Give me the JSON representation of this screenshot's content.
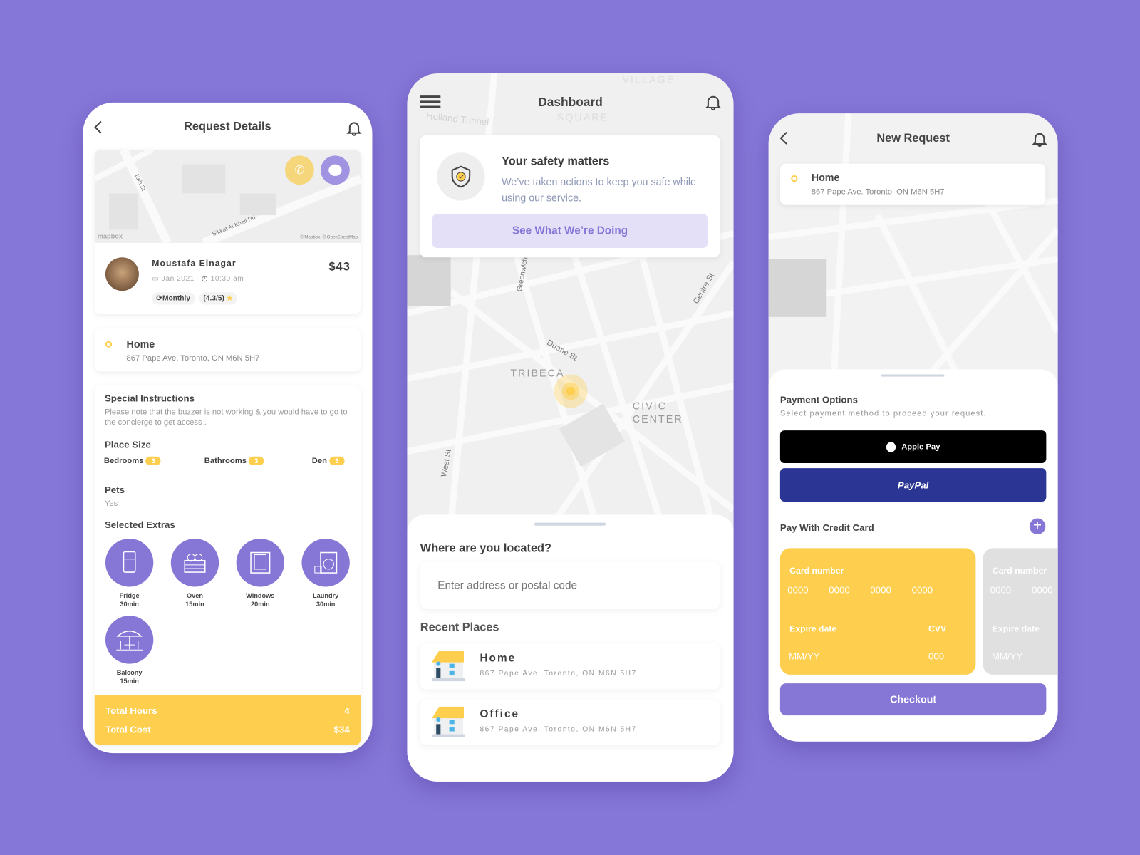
{
  "colors": {
    "background": "#8577d7",
    "accent": "#8677d6",
    "yellow": "#fecf4e",
    "paypal": "#2b3593",
    "apple": "#000000"
  },
  "request_details": {
    "title": "Request Details",
    "map": {
      "street1": "19th St",
      "street2": "Sikkat Al Khail Rd",
      "logo": "mapbox",
      "attribution": "© Mapbox, © OpenStreetMap"
    },
    "provider": {
      "name": "Moustafa Elnagar",
      "date": "Jan 2021",
      "time": "10:30 am",
      "frequency": "Monthly",
      "rating": "(4.3/5)",
      "price": "$43"
    },
    "location": {
      "name": "Home",
      "address": "867 Pape Ave. Toronto, ON M6N 5H7"
    },
    "instructions": {
      "heading": "Special Instructions",
      "text": "Please note that the buzzer is not working & you would have to go to the concierge to get access ."
    },
    "place_size": {
      "heading": "Place Size",
      "items": [
        {
          "label": "Bedrooms",
          "count": "3"
        },
        {
          "label": "Bathrooms",
          "count": "3"
        },
        {
          "label": "Den",
          "count": "3"
        }
      ]
    },
    "pets": {
      "heading": "Pets",
      "value": "Yes"
    },
    "extras": {
      "heading": "Selected Extras",
      "items": [
        {
          "label": "Fridge",
          "duration": "30min",
          "icon": "fridge-icon"
        },
        {
          "label": "Oven",
          "duration": "15min",
          "icon": "oven-icon"
        },
        {
          "label": "Windows",
          "duration": "20min",
          "icon": "window-icon"
        },
        {
          "label": "Laundry",
          "duration": "30min",
          "icon": "washing-machine-icon"
        },
        {
          "label": "Balcony",
          "duration": "15min",
          "icon": "patio-umbrella-icon"
        }
      ]
    },
    "totals": {
      "hours_label": "Total Hours",
      "hours": "4",
      "cost_label": "Total Cost",
      "cost": "$34"
    }
  },
  "dashboard": {
    "title": "Dashboard",
    "safety": {
      "title": "Your safety matters",
      "text": "We’ve taken actions to keep you safe while using our service.",
      "button": "See What We’re Doing"
    },
    "map_labels": [
      "Holland Tunnel",
      "SQUARE",
      "VILLAGE",
      "TRIBECA",
      "CIVIC CENTER",
      "Duane St",
      "West St",
      "Greenwich St",
      "Centre St"
    ],
    "location_question": "Where are you located?",
    "search_placeholder": "Enter address or postal code",
    "recent_heading": "Recent Places",
    "recent": [
      {
        "name": "Home",
        "address": "867 Pape Ave. Toronto, ON M6N 5H7"
      },
      {
        "name": "Office",
        "address": "867 Pape Ave. Toronto, ON M6N 5H7"
      }
    ]
  },
  "new_request": {
    "title": "New Request",
    "location": {
      "name": "Home",
      "address": "867 Pape Ave. Toronto, ON M6N 5H7"
    },
    "payment_heading": "Payment Options",
    "payment_sub": "Select payment method to proceed your request.",
    "apple_pay": "Apple Pay",
    "paypal": "PayPal",
    "credit_heading": "Pay With Credit Card",
    "card": {
      "number_label": "Card number",
      "groups": [
        "0000",
        "0000",
        "0000",
        "0000"
      ],
      "expire_label": "Expire date",
      "expire_placeholder": "MM/YY",
      "cvv_label": "CVV",
      "cvv_placeholder": "000"
    },
    "checkout": "Checkout"
  }
}
